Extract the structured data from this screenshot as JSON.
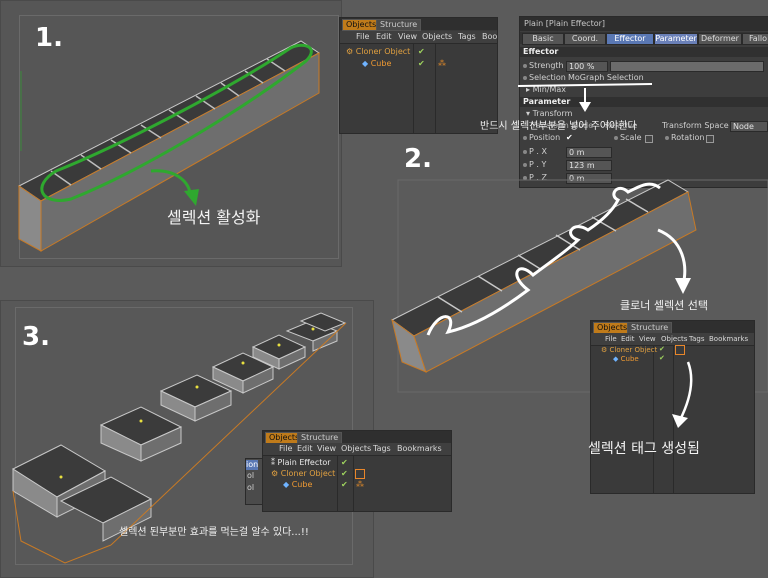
{
  "steps": {
    "one": "1.",
    "two": "2.",
    "three": "3."
  },
  "captions": {
    "selection_activate": "셀렉션 활성화",
    "must_put_selection": "반드시 셀렉션부분을 넣어 주어야한다",
    "cloner_select": "클로너 셀렉션 선택",
    "selection_tag_created": "셀렉션 태그 생성됨",
    "only_selected_effect": "셀렉션 된부분만 효과를 먹는걸 알수 있다...!!"
  },
  "object_manager_top": {
    "tabs": [
      "Objects",
      "Structure"
    ],
    "menu": [
      "File",
      "Edit",
      "View",
      "Objects",
      "Tags",
      "Boo"
    ],
    "rows": [
      {
        "label": "Cloner Object",
        "color": "orange"
      },
      {
        "label": "Cube",
        "color": "lightorange"
      }
    ]
  },
  "object_manager_mid": {
    "tabs": [
      "Objects",
      "Structure"
    ],
    "menu": [
      "File",
      "Edit",
      "View",
      "Objects",
      "Tags",
      "Bookmarks"
    ],
    "rows": [
      {
        "label": "Cloner Object"
      },
      {
        "label": "Cube"
      }
    ]
  },
  "object_manager_bottom": {
    "tabs": [
      "Objects",
      "Structure"
    ],
    "menu": [
      "File",
      "Edit",
      "View",
      "Objects",
      "Tags",
      "Bookmarks"
    ],
    "rows": [
      {
        "label": "Plain Effector"
      },
      {
        "label": "Cloner Object"
      },
      {
        "label": "Cube"
      }
    ],
    "side_labels": [
      "ion",
      "ol",
      "ol"
    ]
  },
  "attribute_manager": {
    "title": "Plain [Plain Effector]",
    "tabs": [
      "Basic",
      "Coord.",
      "Effector",
      "Parameter",
      "Deformer",
      "Fallo"
    ],
    "effector_section": "Effector",
    "strength_label": "Strength",
    "strength_value": "100 %",
    "selection_label": "Selection",
    "selection_value": "MoGraph Selection",
    "minmax_label": "Min/Max",
    "parameter_section": "Parameter",
    "transform_label": "Transform",
    "transform_mode_label": "Transform Mode",
    "transform_mode_value": "Relative",
    "transform_space_label": "Transform Space",
    "transform_space_value": "Node",
    "position_label": "Position",
    "scale_label": "Scale",
    "rotation_label": "Rotation",
    "px_label": "P . X",
    "px_value": "0 m",
    "py_label": "P . Y",
    "py_value": "123 m",
    "pz_label": "P . Z",
    "pz_value": "0 m"
  },
  "colors": {
    "background": "#5b5b5b",
    "green_stroke": "#2fa82f",
    "accent_orange": "#e0a040",
    "tab_blue": "#5a78b4"
  }
}
